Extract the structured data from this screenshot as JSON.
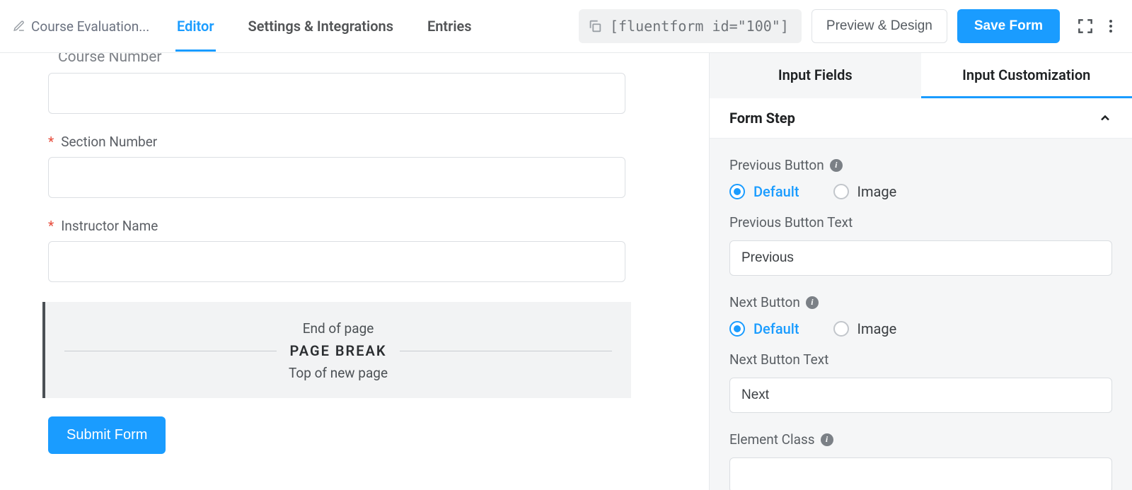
{
  "header": {
    "form_name": "Course Evaluation...",
    "tabs": {
      "editor": "Editor",
      "settings": "Settings & Integrations",
      "entries": "Entries"
    },
    "shortcode": "[fluentform id=\"100\"]",
    "preview_design": "Preview & Design",
    "save": "Save Form"
  },
  "canvas": {
    "course_number_label": "Course Number",
    "section_number_label": "Section Number",
    "instructor_name_label": "Instructor Name",
    "page_break": {
      "end": "End of page",
      "title": "PAGE BREAK",
      "top": "Top of new page"
    },
    "submit": "Submit Form"
  },
  "sidebar": {
    "tabs": {
      "input_fields": "Input Fields",
      "input_customization": "Input Customization"
    },
    "panel_title": "Form Step",
    "prev_button_label": "Previous Button",
    "prev_default": "Default",
    "prev_image": "Image",
    "prev_text_label": "Previous Button Text",
    "prev_text_value": "Previous",
    "next_button_label": "Next Button",
    "next_default": "Default",
    "next_image": "Image",
    "next_text_label": "Next Button Text",
    "next_text_value": "Next",
    "element_class_label": "Element Class"
  }
}
